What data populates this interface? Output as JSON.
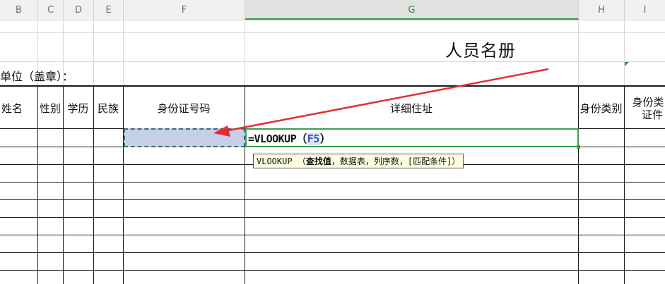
{
  "column_headers": [
    "B",
    "C",
    "D",
    "E",
    "F",
    "G",
    "H",
    "I"
  ],
  "active_column": "G",
  "title": "人员名册",
  "unit_label": "单位（盖章）：",
  "table_headers": {
    "name": "姓名",
    "gender": "性别",
    "education": "学历",
    "ethnicity": "民族",
    "id_number": "身份证号码",
    "address": "详细住址",
    "id_type": "身份类别",
    "id_cert_line1": "身份类",
    "id_cert_line2": "证件"
  },
  "formula": {
    "prefix": "=VLOOKUP（",
    "ref": "F5",
    "suffix": "）"
  },
  "tooltip": {
    "func": "VLOOKUP",
    "open": "（",
    "arg_current": "查找值",
    "rest": "，数据表，列序数，[匹配条件]）"
  },
  "colors": {
    "accent_green": "#3ba04a",
    "arrow_red": "#e03030",
    "selection_fill": "#c6cee8"
  }
}
